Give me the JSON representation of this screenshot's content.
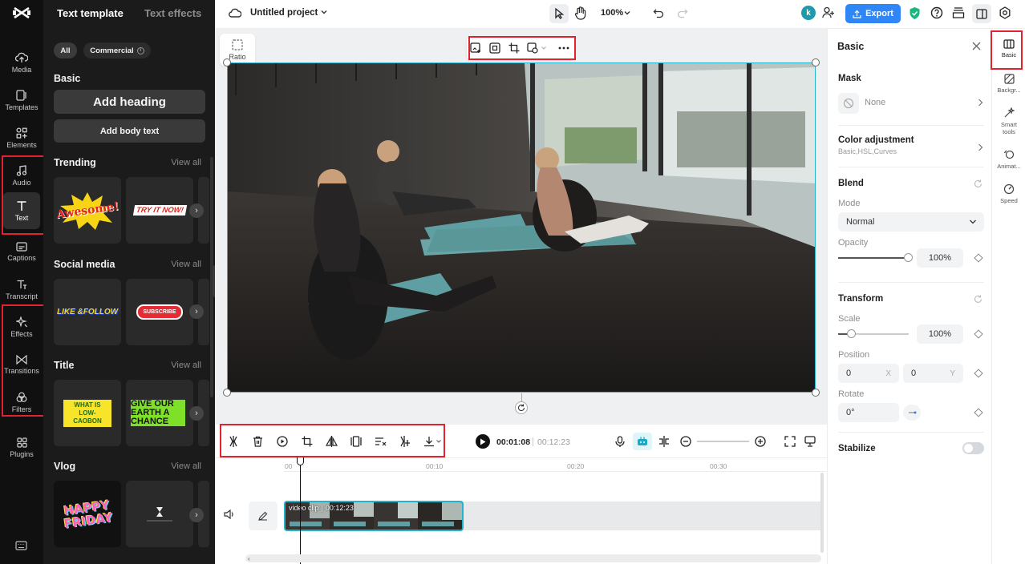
{
  "rail": {
    "items": [
      {
        "label": "Media",
        "icon": "cloud-upload-icon"
      },
      {
        "label": "Templates",
        "icon": "templates-icon"
      },
      {
        "label": "Elements",
        "icon": "elements-icon"
      },
      {
        "label": "Audio",
        "icon": "music-note-icon"
      },
      {
        "label": "Text",
        "icon": "text-icon"
      },
      {
        "label": "Captions",
        "icon": "captions-icon"
      },
      {
        "label": "Transcript",
        "icon": "transcript-icon"
      },
      {
        "label": "Effects",
        "icon": "sparkle-icon"
      },
      {
        "label": "Transitions",
        "icon": "transition-icon"
      },
      {
        "label": "Filters",
        "icon": "filters-icon"
      },
      {
        "label": "Plugins",
        "icon": "plugins-icon"
      }
    ],
    "active": "Text"
  },
  "panel": {
    "tabs": [
      "Text template",
      "Text effects"
    ],
    "chips": [
      "All",
      "Commercial"
    ],
    "basic_title": "Basic",
    "add_heading": "Add heading",
    "add_body": "Add body text",
    "sections": [
      {
        "title": "Trending",
        "view_all": "View all",
        "tiles": [
          "Awesome!",
          "TRY IT NOW!"
        ]
      },
      {
        "title": "Social media",
        "view_all": "View all",
        "tiles": [
          "LIKE &FOLLOW",
          "SUBSCRIBE"
        ]
      },
      {
        "title": "Title",
        "view_all": "View all",
        "tiles": [
          "WHAT IS LOW-CAOBON",
          "GIVE OUR EARTH A CHANCE"
        ]
      },
      {
        "title": "Vlog",
        "view_all": "View all",
        "tiles": [
          "HAPPY FRIDAY",
          ""
        ]
      }
    ]
  },
  "topbar": {
    "project_name": "Untitled project",
    "zoom": "100%",
    "avatar_letter": "k",
    "export_label": "Export"
  },
  "canvas": {
    "ratio_label": "Ratio"
  },
  "timeline": {
    "current_time": "00:01:08",
    "total_time": "00:12:23",
    "ruler": [
      "00",
      "00:10",
      "00:20",
      "00:30"
    ],
    "clip_label": "video clip",
    "clip_duration": "00:12:23"
  },
  "right_panel": {
    "title": "Basic",
    "mask_label": "Mask",
    "mask_value": "None",
    "color_label": "Color adjustment",
    "color_sub": "Basic,HSL,Curves",
    "blend_label": "Blend",
    "mode_label": "Mode",
    "mode_value": "Normal",
    "opacity_label": "Opacity",
    "opacity_value": "100%",
    "opacity_fraction": 1.0,
    "transform_label": "Transform",
    "scale_label": "Scale",
    "scale_value": "100%",
    "position_label": "Position",
    "pos_x": "0",
    "pos_x_axis": "X",
    "pos_y": "0",
    "pos_y_axis": "Y",
    "rotate_label": "Rotate",
    "rotate_value": "0°",
    "stabilize_label": "Stabilize"
  },
  "right_rail": [
    {
      "label": "Basic"
    },
    {
      "label": "Backgr..."
    },
    {
      "label": "Smart tools"
    },
    {
      "label": "Animat..."
    },
    {
      "label": "Speed"
    }
  ],
  "colors": {
    "accent": "#1aa9c7",
    "export_bg": "#2f86f6",
    "highlight": "#e0232f"
  }
}
